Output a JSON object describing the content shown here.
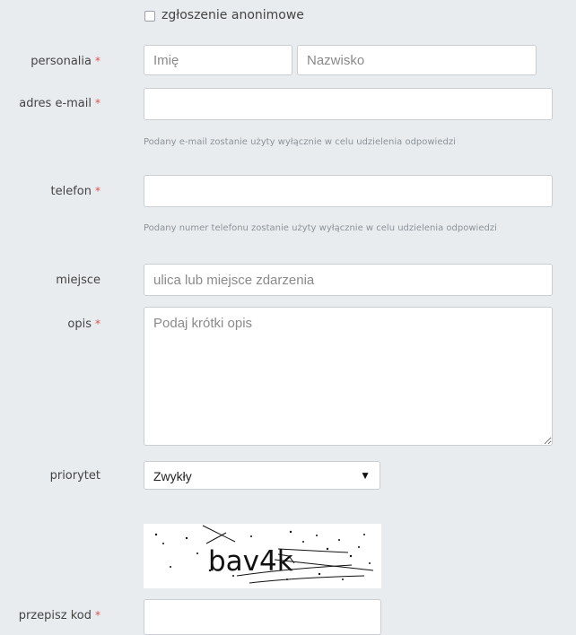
{
  "anonymous": {
    "label": "zgłoszenie anonimowe"
  },
  "personalia": {
    "label": "personalia",
    "first_name_placeholder": "Imię",
    "last_name_placeholder": "Nazwisko"
  },
  "email": {
    "label": "adres e-mail",
    "hint": "Podany e-mail zostanie użyty wyłącznie w celu udzielenia odpowiedzi"
  },
  "phone": {
    "label": "telefon",
    "hint": "Podany numer telefonu zostanie użyty wyłącznie w celu udzielenia odpowiedzi"
  },
  "place": {
    "label": "miejsce",
    "placeholder": "ulica lub miejsce zdarzenia"
  },
  "description": {
    "label": "opis",
    "placeholder": "Podaj krótki opis"
  },
  "priority": {
    "label": "priorytet",
    "value": "Zwykły",
    "arrow": "▼"
  },
  "captcha": {
    "text": "bav4k"
  },
  "code": {
    "label": "przepisz kod"
  },
  "required_mark": "*",
  "colors": {
    "background": "#e8ecef",
    "required": "#e0524a",
    "hint": "#8c9399"
  }
}
